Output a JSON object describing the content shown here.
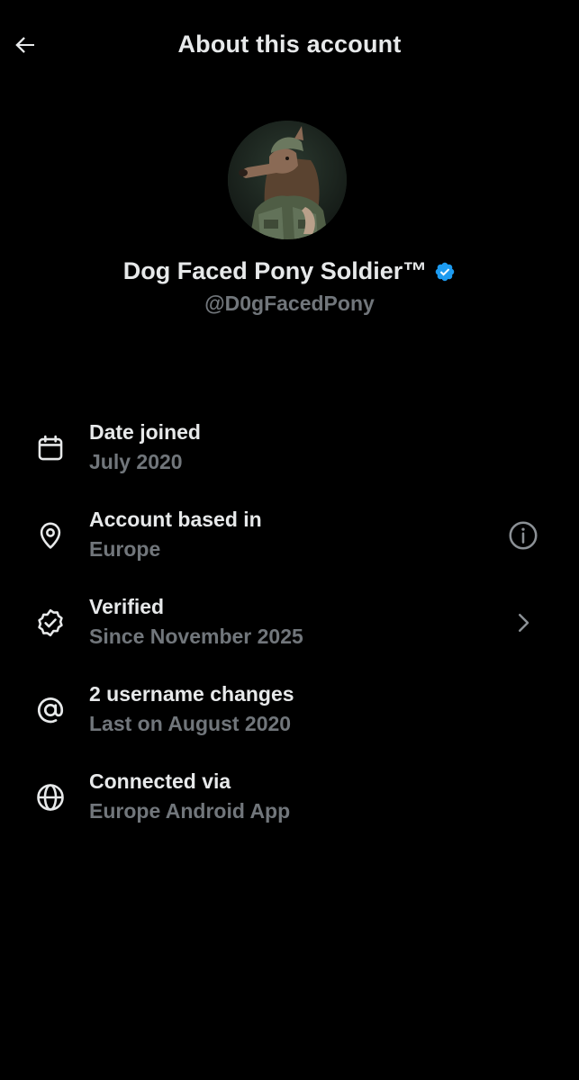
{
  "header": {
    "back_icon": "arrow-left-icon",
    "title": "About this account"
  },
  "profile": {
    "avatar_icon": "dog-soldier-avatar",
    "display_name": "Dog Faced Pony Soldier™",
    "verified_icon": "verified-badge-icon",
    "verified_color": "#1d9bf0",
    "handle": "@D0gFacedPony"
  },
  "info": [
    {
      "icon": "calendar-icon",
      "label": "Date joined",
      "value": "July 2020"
    },
    {
      "icon": "location-pin-icon",
      "label": "Account based in",
      "value": "Europe",
      "action_icon": "info-icon"
    },
    {
      "icon": "verified-check-icon",
      "label": "Verified",
      "value": "Since November 2025",
      "action_icon": "chevron-right-icon"
    },
    {
      "icon": "at-sign-icon",
      "label": "2 username changes",
      "value": "Last on August 2020"
    },
    {
      "icon": "globe-icon",
      "label": "Connected via",
      "value": "Europe Android App"
    }
  ],
  "colors": {
    "background": "#000000",
    "primary_text": "#e7e9ea",
    "secondary_text": "#71767b",
    "accent": "#1d9bf0"
  }
}
